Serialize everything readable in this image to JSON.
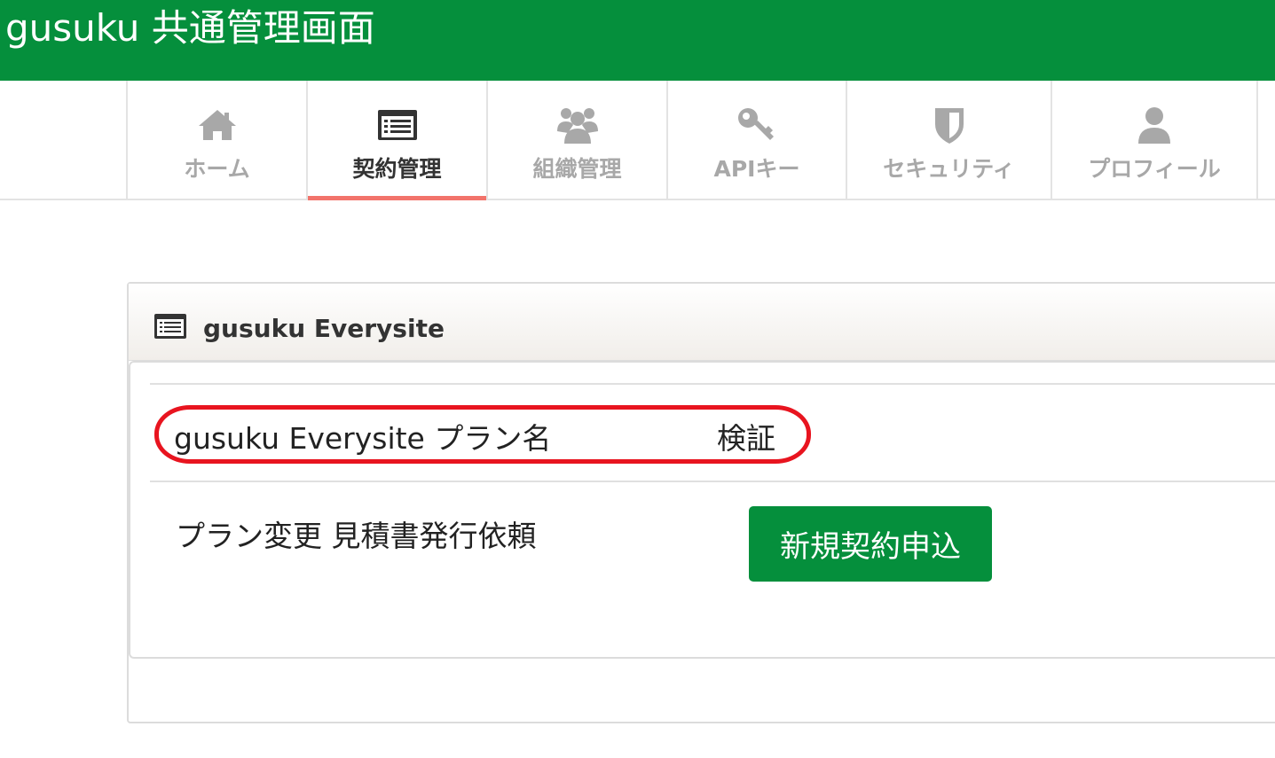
{
  "header": {
    "title": "gusuku 共通管理画面"
  },
  "nav": {
    "tabs": [
      {
        "label": "ホーム",
        "icon": "home-icon",
        "active": false
      },
      {
        "label": "契約管理",
        "icon": "list-icon",
        "active": true
      },
      {
        "label": "組織管理",
        "icon": "group-icon",
        "active": false
      },
      {
        "label": "APIキー",
        "icon": "key-icon",
        "active": false
      },
      {
        "label": "セキュリティ",
        "icon": "shield-icon",
        "active": false
      },
      {
        "label": "プロフィール",
        "icon": "user-icon",
        "active": false
      }
    ]
  },
  "panel": {
    "icon": "list-icon",
    "title": "gusuku Everysite",
    "plan_label": "gusuku Everysite プラン名",
    "plan_value": "検証",
    "change_label": "プラン変更 見積書発行依頼",
    "new_contract_button": "新規契約申込"
  },
  "colors": {
    "brand_green": "#058f3c",
    "active_tab_underline": "#f2736b",
    "highlight_ring": "#e8141f",
    "inactive_text": "#a8a8a8"
  }
}
